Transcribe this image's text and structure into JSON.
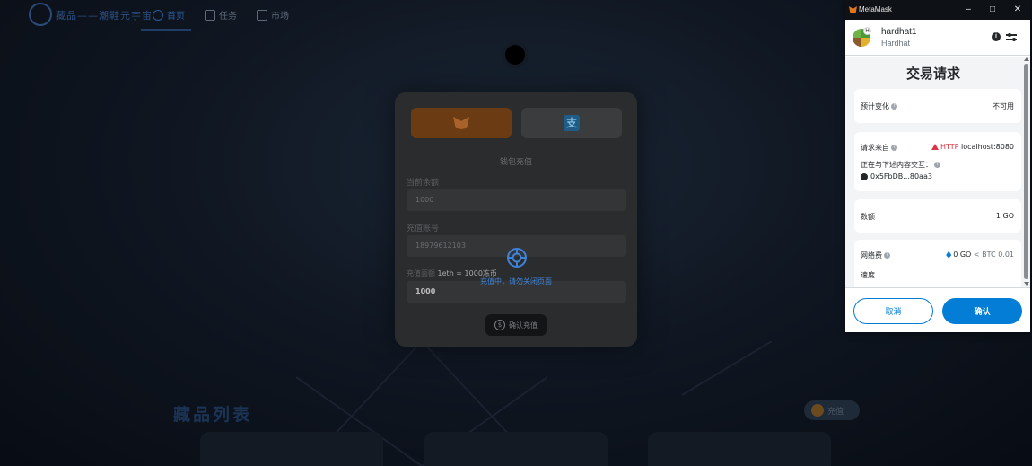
{
  "app": {
    "brand": "藏品——潮鞋元宇宙",
    "nav": [
      {
        "label": "首页"
      },
      {
        "label": "任务"
      },
      {
        "label": "市场"
      }
    ],
    "collections_title": "藏品列表",
    "fox_pill_label": "充值"
  },
  "recharge_modal": {
    "tabs": [
      {
        "icon": "metamask-fox-icon"
      },
      {
        "icon": "alipay-icon",
        "glyph": "支"
      }
    ],
    "caption": "钱包充值",
    "balance_label": "当前余额",
    "balance_value": "1000",
    "account_label": "充值账号",
    "account_value": "18979612103",
    "amount_label": "充值面额",
    "rate_text": "1eth = 1000冻币",
    "amount_value": "1000",
    "loading_text": "充值中，请勿关闭页面",
    "confirm_label": "确认充值",
    "confirm_icon_glyph": "$"
  },
  "metamask": {
    "window_title": "MetaMask",
    "window_controls": [
      "–",
      "□",
      "✕"
    ],
    "account_name": "hardhat1",
    "account_badge": "H",
    "network": "Hardhat",
    "heading": "交易请求",
    "estimated_changes_label": "预计变化",
    "estimated_changes_value": "不可用",
    "request_from_label": "请求来自",
    "http_badge": "HTTP",
    "origin": "localhost:8080",
    "interacting_with_label": "正在与下述内容交互：",
    "contract_address": "0x5FbDB...80aa3",
    "amount_label": "数额",
    "amount_value": "1 GO",
    "network_fee_label": "网络费",
    "network_fee_value": "0 GO",
    "network_fee_fiat": "< BTC 0.01",
    "speed_label": "速度",
    "cancel_label": "取消",
    "confirm_label": "确认"
  },
  "colors": {
    "metamask_blue": "#037dd6",
    "loading_blue": "#3f83d8",
    "warning_red": "#d73847"
  }
}
